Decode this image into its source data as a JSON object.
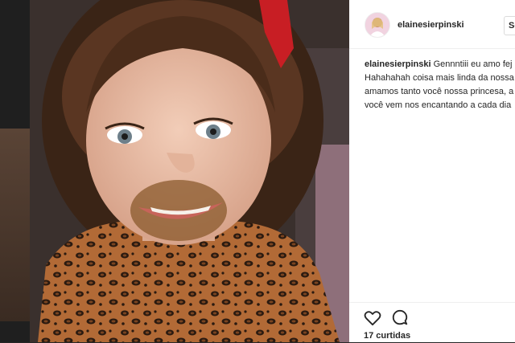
{
  "post": {
    "username": "elainesierpinski",
    "follow_label": "Se",
    "caption_user": "elainesierpinski",
    "caption_lines": [
      "Gennntiii eu amo fej",
      "Hahahahah coisa mais linda da nossa",
      "amamos tanto você nossa princesa, a",
      "você vem nos encantando a cada dia"
    ],
    "likes": "17 curtidas"
  },
  "icons": {
    "like": "heart-icon",
    "comment": "comment-icon"
  },
  "colors": {
    "text": "#262626",
    "panel_bg": "#ffffff",
    "divider": "#efefef"
  }
}
